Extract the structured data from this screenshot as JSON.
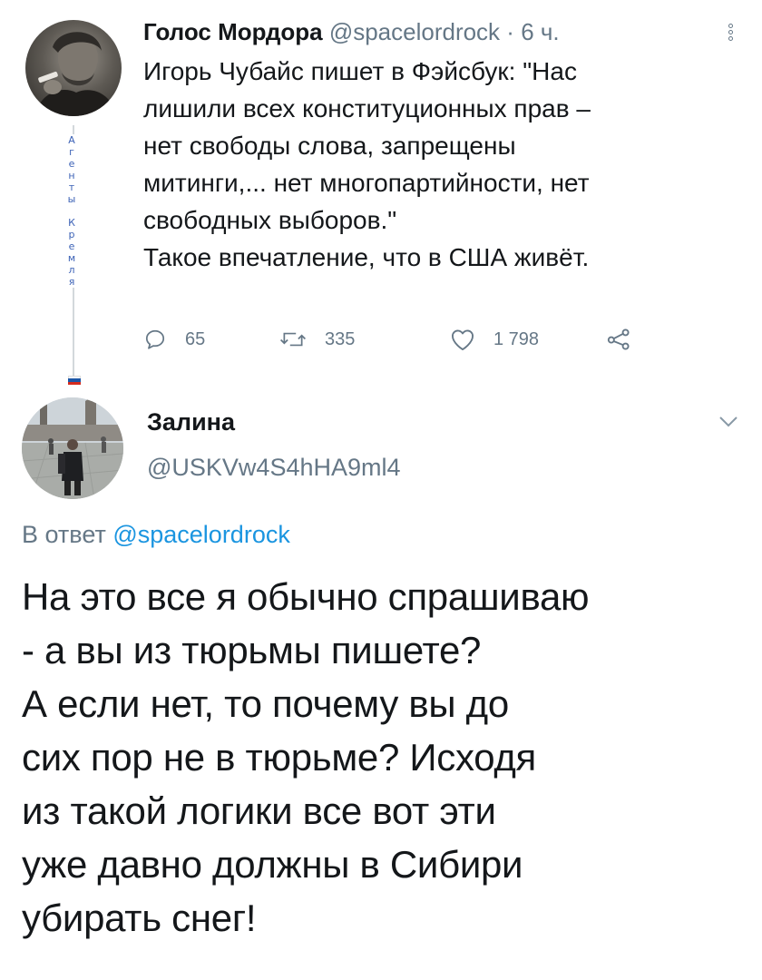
{
  "parent_tweet": {
    "author_name": "Голос Мордора",
    "handle": "@spacelordrock",
    "separator": "·",
    "time": "6 ч.",
    "text": "Игорь Чубайс пишет в Фэйсбук: \"Нас\nлишили всех конституционных прав –\nнет свободы слова, запрещены\nмитинги,... нет многопартийности, нет\nсвободных выборов.\"\nТакое впечатление, что в США живёт.",
    "side_label": [
      "А",
      "г",
      "е",
      "н",
      "т",
      "ы",
      "",
      "К",
      "р",
      "е",
      "м",
      "л",
      "я"
    ],
    "actions": {
      "reply_count": "65",
      "retweet_count": "335",
      "like_count": "1 798"
    }
  },
  "reply_tweet": {
    "author_name": "Залина",
    "handle": "@USKVw4S4hHA9ml4",
    "reply_prefix": "В ответ",
    "reply_link": "@spacelordrock",
    "text": "На это все я обычно спрашиваю\n- а вы из тюрьмы пишете?\nА если нет, то почему вы до\nсих пор не в тюрьме? Исходя\nиз такой логики все вот эти\nуже давно должны в Сибири\nубирать снег!"
  },
  "colors": {
    "text_primary": "#14171a",
    "text_secondary": "#657786",
    "link": "#1b95e0",
    "side_label": "#3c62b6"
  },
  "icons": [
    "reply-icon",
    "retweet-icon",
    "like-icon",
    "share-icon",
    "more-menu-icon",
    "chevron-down-icon",
    "russian-flag-icon"
  ]
}
